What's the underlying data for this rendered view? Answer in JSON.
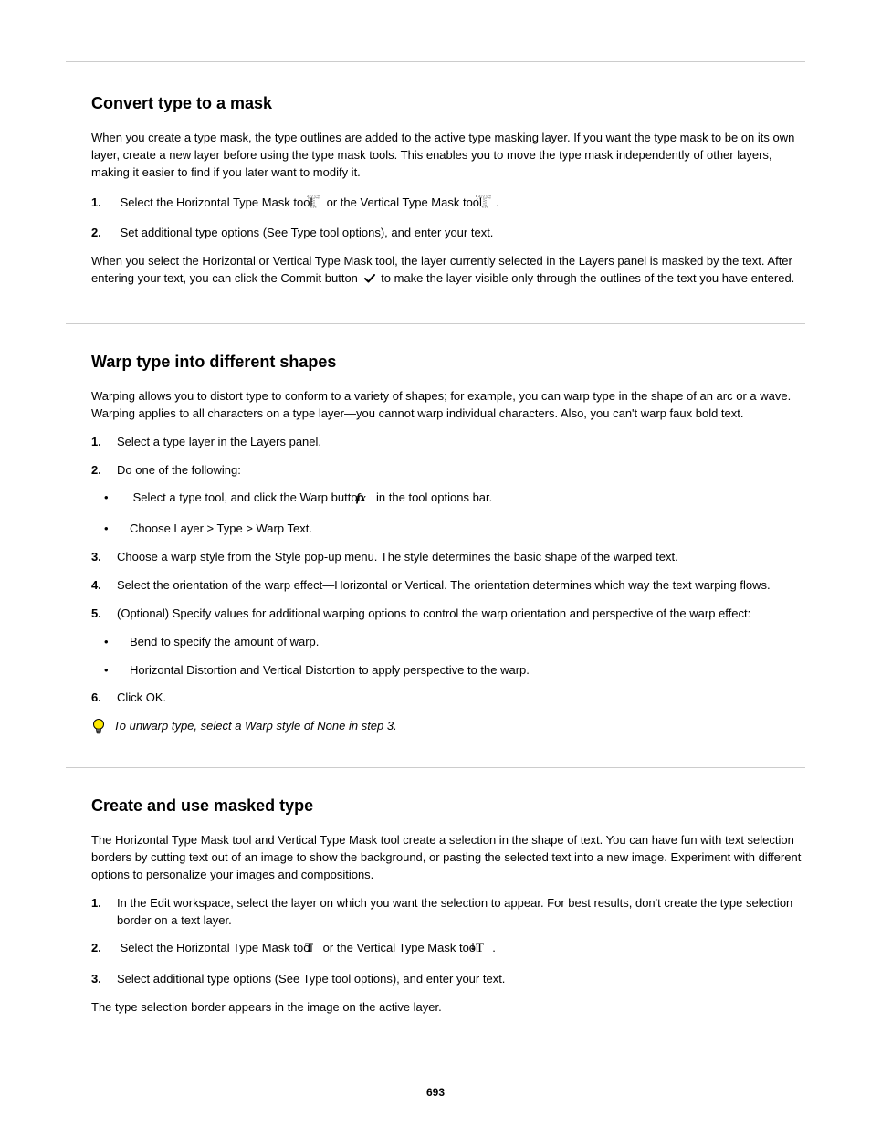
{
  "s1": {
    "h": "Convert type to a mask",
    "p1": "When you create a type mask, the type outlines are added to the active type masking layer. If you want the type mask to be on its own layer, create a new layer before using the type mask tools. This enables you to move the type mask independently of other layers, making it easier to find if you later want to modify it.",
    "step1_a": "Select the Horizontal Type Mask tool",
    "step1_b": "or the Vertical Type Mask tool",
    "step1_c": ".",
    "step2": "Set additional type options (See Type tool options), and enter your text.",
    "p2_a": "When you select the Horizontal or Vertical Type Mask tool, the layer currently selected in the Layers panel is masked by the text. After entering your text, you can click the Commit button",
    "p2_b": "to make the layer visible only through the outlines of the text you have entered."
  },
  "s2": {
    "h": "Warp type into different shapes",
    "p1": "Warping allows you to distort type to conform to a variety of shapes; for example, you can warp type in the shape of an arc or a wave. Warping applies to all characters on a type layer—you cannot warp individual characters. Also, you can't warp faux bold text.",
    "step1": "Select a type layer in the Layers panel.",
    "step2": "Do one of the following:",
    "sub_a_1": "Select a type tool, and click the Warp button",
    "sub_a_2": "in the tool options bar.",
    "sub_b": "Choose Layer > Type > Warp Text.",
    "step3": "Choose a warp style from the Style pop-up menu. The style determines the basic shape of the warped text.",
    "step4": "Select the orientation of the warp effect—Horizontal or Vertical. The orientation determines which way the text warping flows.",
    "step5": "(Optional) Specify values for additional warping options to control the warp orientation and perspective of the warp effect:",
    "sub5_a": "Bend to specify the amount of warp.",
    "sub5_b": "Horizontal Distortion and Vertical Distortion to apply perspective to the warp.",
    "step6": "Click OK.",
    "tip": "To unwarp type, select a Warp style of None in step 3."
  },
  "s3": {
    "h": "Create and use masked type",
    "p1": "The Horizontal Type Mask tool and Vertical Type Mask tool create a selection in the shape of text. You can have fun with text selection borders by cutting text out of an image to show the background, or pasting the selected text into a new image. Experiment with different options to personalize your images and compositions.",
    "step1_a": "In the Edit workspace, select the layer on which you want the selection to appear. For best results, don't create the type selection border on a text layer.",
    "step2_a": "Select the Horizontal Type Mask tool",
    "step2_b": "or the Vertical Type Mask tool",
    "step2_c": ".",
    "step3": "Select additional type options (See Type tool options), and enter your text.",
    "p2": "The type selection border appears in the image on the active layer."
  },
  "page_number": "693"
}
